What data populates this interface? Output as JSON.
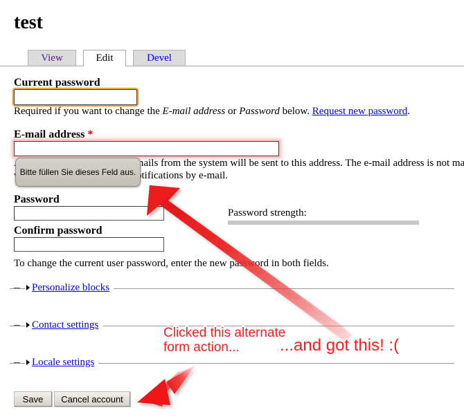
{
  "page": {
    "title": "test"
  },
  "tabs": [
    {
      "label": "View",
      "active": false,
      "state": "visited"
    },
    {
      "label": "Edit",
      "active": true,
      "state": "active"
    },
    {
      "label": "Devel",
      "active": false,
      "state": "link"
    }
  ],
  "form": {
    "current_password": {
      "label": "Current password",
      "value": "",
      "description_before": "Required if you want to change the ",
      "description_em1": "E-mail address",
      "description_mid": " or ",
      "description_em2": "Password",
      "description_after": " below. ",
      "link_text": "Request new password",
      "description_end": "."
    },
    "email": {
      "label": "E-mail address",
      "required_marker": "*",
      "value": "",
      "description_line1": "A valid e-mail address. All e-mails from the system will be sent to this address. The e-mail address is not made public a",
      "description_line2": "will receive certain news or notifications by e-mail.",
      "validation_tooltip": "Bitte füllen Sie dieses Feld aus."
    },
    "password": {
      "label": "Password",
      "value": ""
    },
    "confirm_password": {
      "label": "Confirm password",
      "value": "",
      "description": "To change the current user password, enter the new password in both fields."
    },
    "password_strength": {
      "label": "Password strength:",
      "meter_value": ""
    }
  },
  "fieldsets": [
    {
      "label": "Personalize blocks",
      "collapsed": true
    },
    {
      "label": "Contact settings",
      "collapsed": true
    },
    {
      "label": "Locale settings",
      "collapsed": true
    }
  ],
  "buttons": {
    "save": "Save",
    "cancel_account": "Cancel account"
  },
  "annotations": {
    "clicked": "Clicked this alternate\nform action...",
    "got_this": "...and got this! :("
  },
  "colors": {
    "annotation_red": "#ff1a1a",
    "arrow_red": "#ee1111",
    "focus_orange": "#e8a33d",
    "invalid_pink": "#ffc2c2",
    "link_blue": "#0000ee",
    "visited_purple": "#551a8b",
    "tab_inactive_bg": "#dcdcdc",
    "strength_bar_gray": "#c6c6c6"
  },
  "icons": {
    "fieldset_collapse": "minus-icon",
    "fieldset_expand": "caret-right-icon",
    "pointer_big": "arrow-up-left-icon",
    "pointer_small": "arrow-down-left-icon"
  }
}
